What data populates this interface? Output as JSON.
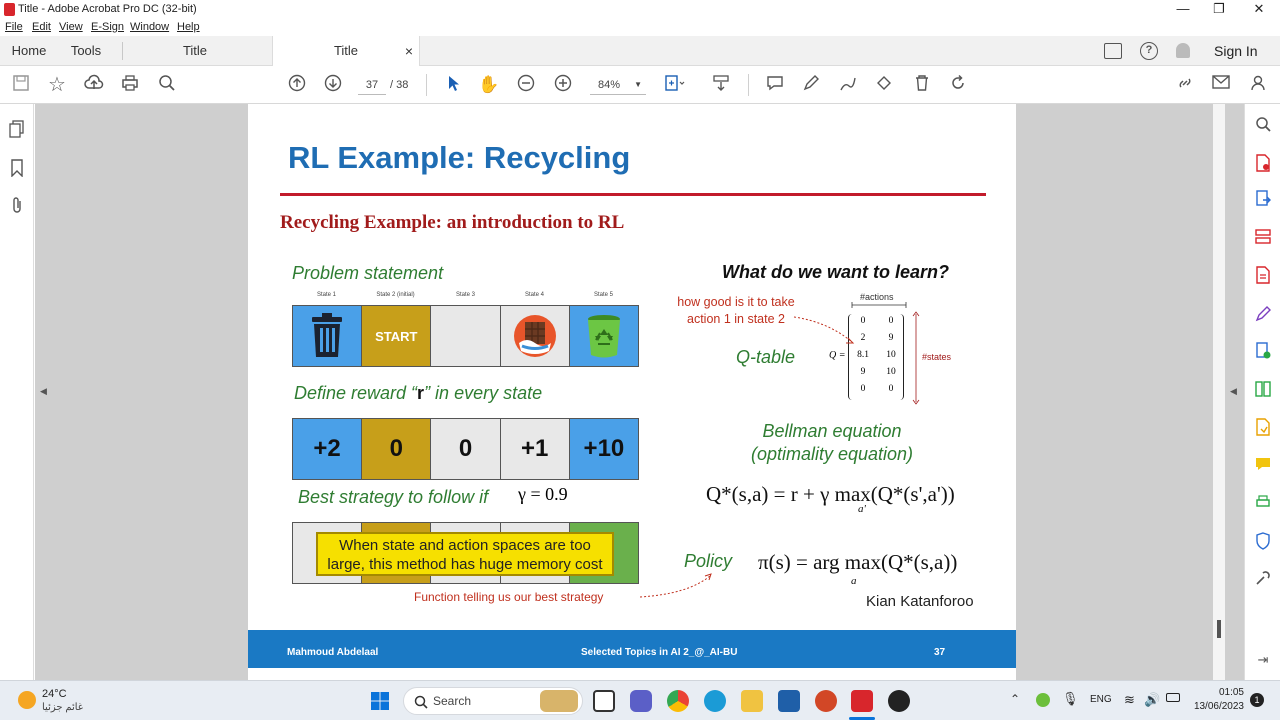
{
  "window": {
    "title": "Title - Adobe Acrobat Pro DC (32-bit)",
    "controls": [
      "—",
      "❐",
      "✕"
    ]
  },
  "menu": [
    "File",
    "Edit",
    "View",
    "E-Sign",
    "Window",
    "Help"
  ],
  "tabs": {
    "home": "Home",
    "tools": "Tools",
    "doc1": "Title",
    "doc2": "Title",
    "close": "×",
    "sign_in": "Sign In"
  },
  "toolbar": {
    "page_current": "37",
    "page_total": "/ 38",
    "zoom": "84%"
  },
  "slide": {
    "title": "RL Example: Recycling",
    "subtitle": "Recycling Example: an introduction to RL",
    "problem_statement": "Problem statement",
    "state_labels": [
      "State 1",
      "State 2 (initial)",
      "State 3",
      "State 4",
      "State 5"
    ],
    "start_label": "START",
    "define_reward_pre": "Define reward “",
    "define_reward_r": "r",
    "define_reward_post": "” in every state",
    "rewards": [
      "+2",
      "0",
      "0",
      "+1",
      "+10"
    ],
    "best_strategy": "Best strategy to follow if",
    "gamma": "γ = 0.9",
    "memory_line1": "When state and action spaces are too",
    "memory_line2": "large, this method has huge memory cost",
    "policy_note": "Function telling us our best strategy",
    "learn_title": "What do we want to learn?",
    "howgood_line1": "how good is it to take",
    "howgood_line2": "action 1 in state 2",
    "actions_label": "#actions",
    "states_label": "#states",
    "qtable_label": "Q-table",
    "q_eq": "Q =",
    "matrix": [
      [
        "0",
        "0"
      ],
      [
        "2",
        "9"
      ],
      [
        "8.1",
        "10"
      ],
      [
        "9",
        "10"
      ],
      [
        "0",
        "0"
      ]
    ],
    "bellman_line1": "Bellman equation",
    "bellman_line2": "(optimality equation)",
    "bellman_formula": "Q*(s,a) = r + γ max(Q*(s',a'))",
    "bellman_sub": "a'",
    "policy_label": "Policy",
    "policy_formula": "π(s) = arg max(Q*(s,a))",
    "policy_sub": "a",
    "author": "Kian Katanforoo",
    "footer_left": "Mahmoud Abdelaal",
    "footer_center": "Selected Topics in AI 2_@_AI-BU",
    "footer_page": "37",
    "colors": {
      "blue_cell": "#4aa0e8",
      "gold_cell": "#c79f1a",
      "grey_cell": "#e8e8e8",
      "green_cell": "#6ab04c",
      "title_blue": "#1f6db3",
      "rule_red": "#c21b2b"
    }
  },
  "taskbar": {
    "weather_temp": "24°C",
    "weather_desc": "غائم جزئيا",
    "search": "Search",
    "lang": "ENG",
    "time": "01:05",
    "date": "13/06/2023",
    "notif_count": "1"
  }
}
